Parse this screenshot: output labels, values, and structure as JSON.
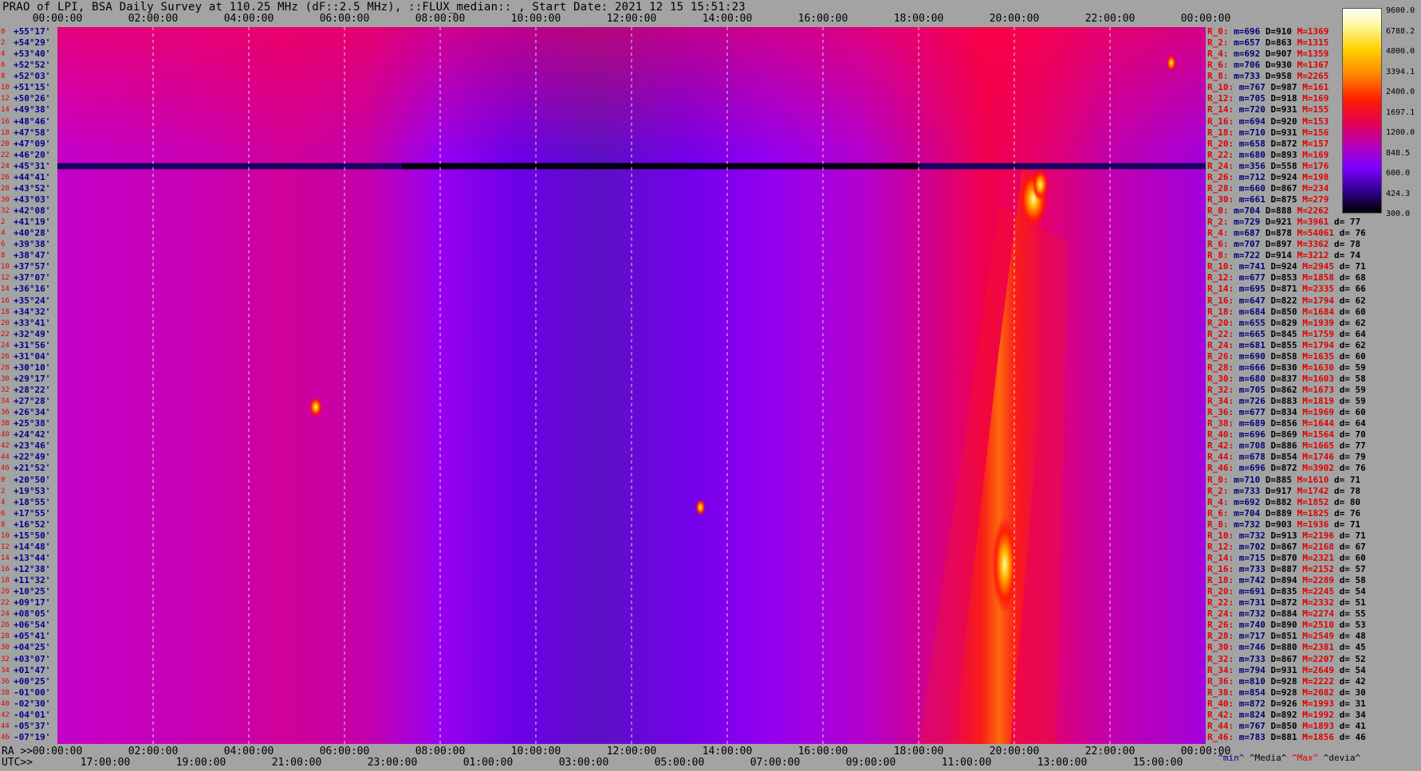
{
  "title": "PRAO of LPI, BSA Daily Survey at 110.25 MHz (dF::2.5 MHz), ::FLUX_median:: , Start Date: 2021 12 15 15:51:23",
  "chart_data": {
    "type": "heatmap",
    "title": "PRAO of LPI, BSA Daily Survey at 110.25 MHz (dF::2.5 MHz), ::FLUX_median:: , Start Date: 2021 12 15 15:51:23",
    "x_top_ticks": [
      "00:00:00",
      "02:00:00",
      "04:00:00",
      "06:00:00",
      "08:00:00",
      "10:00:00",
      "12:00:00",
      "14:00:00",
      "16:00:00",
      "18:00:00",
      "20:00:00",
      "22:00:00",
      "00:00:00"
    ],
    "x_bottom_ra_label": "RA >>",
    "x_bottom_ra_ticks": [
      "00:00:00",
      "02:00:00",
      "04:00:00",
      "06:00:00",
      "08:00:00",
      "10:00:00",
      "12:00:00",
      "14:00:00",
      "16:00:00",
      "18:00:00",
      "20:00:00",
      "22:00:00",
      "00:00:00"
    ],
    "x_bottom_utc_label": "UTC>>",
    "x_bottom_utc_ticks": [
      "17:00:00",
      "19:00:00",
      "21:00:00",
      "23:00:00",
      "01:00:00",
      "03:00:00",
      "05:00:00",
      "07:00:00",
      "09:00:00",
      "11:00:00",
      "13:00:00",
      "15:00:00"
    ],
    "colorbar_ticks": [
      "9600.0",
      "6788.2",
      "4800.0",
      "3394.1",
      "2400.0",
      "1697.1",
      "1200.0",
      "848.5",
      "600.0",
      "424.3",
      "300.0"
    ],
    "declinations": [
      {
        "i": "0",
        "dec": "+55°17'"
      },
      {
        "i": "2",
        "dec": "+54°29'"
      },
      {
        "i": "4",
        "dec": "+53°40'"
      },
      {
        "i": "6",
        "dec": "+52°52'"
      },
      {
        "i": "8",
        "dec": "+52°03'"
      },
      {
        "i": "10",
        "dec": "+51°15'"
      },
      {
        "i": "12",
        "dec": "+50°26'"
      },
      {
        "i": "14",
        "dec": "+49°38'"
      },
      {
        "i": "16",
        "dec": "+48°46'"
      },
      {
        "i": "18",
        "dec": "+47°58'"
      },
      {
        "i": "20",
        "dec": "+47°09'"
      },
      {
        "i": "22",
        "dec": "+46°20'"
      },
      {
        "i": "24",
        "dec": "+45°31'"
      },
      {
        "i": "26",
        "dec": "+44°41'"
      },
      {
        "i": "28",
        "dec": "+43°52'"
      },
      {
        "i": "30",
        "dec": "+43°03'"
      },
      {
        "i": "32",
        "dec": "+42°08'"
      },
      {
        "i": "2",
        "dec": "+41°19'"
      },
      {
        "i": "4",
        "dec": "+40°28'"
      },
      {
        "i": "6",
        "dec": "+39°38'"
      },
      {
        "i": "8",
        "dec": "+38°47'"
      },
      {
        "i": "10",
        "dec": "+37°57'"
      },
      {
        "i": "12",
        "dec": "+37°07'"
      },
      {
        "i": "14",
        "dec": "+36°16'"
      },
      {
        "i": "16",
        "dec": "+35°24'"
      },
      {
        "i": "18",
        "dec": "+34°32'"
      },
      {
        "i": "20",
        "dec": "+33°41'"
      },
      {
        "i": "22",
        "dec": "+32°49'"
      },
      {
        "i": "24",
        "dec": "+31°56'"
      },
      {
        "i": "26",
        "dec": "+31°04'"
      },
      {
        "i": "28",
        "dec": "+30°10'"
      },
      {
        "i": "30",
        "dec": "+29°17'"
      },
      {
        "i": "32",
        "dec": "+28°22'"
      },
      {
        "i": "34",
        "dec": "+27°28'"
      },
      {
        "i": "36",
        "dec": "+26°34'"
      },
      {
        "i": "38",
        "dec": "+25°38'"
      },
      {
        "i": "40",
        "dec": "+24°42'"
      },
      {
        "i": "42",
        "dec": "+23°46'"
      },
      {
        "i": "44",
        "dec": "+22°49'"
      },
      {
        "i": "46",
        "dec": "+21°52'"
      },
      {
        "i": "0",
        "dec": "+20°50'"
      },
      {
        "i": "2",
        "dec": "+19°53'"
      },
      {
        "i": "4",
        "dec": "+18°55'"
      },
      {
        "i": "6",
        "dec": "+17°55'"
      },
      {
        "i": "8",
        "dec": "+16°52'"
      },
      {
        "i": "10",
        "dec": "+15°50'"
      },
      {
        "i": "12",
        "dec": "+14°48'"
      },
      {
        "i": "14",
        "dec": "+13°44'"
      },
      {
        "i": "16",
        "dec": "+12°38'"
      },
      {
        "i": "18",
        "dec": "+11°32'"
      },
      {
        "i": "20",
        "dec": "+10°25'"
      },
      {
        "i": "22",
        "dec": "+09°17'"
      },
      {
        "i": "24",
        "dec": "+08°05'"
      },
      {
        "i": "26",
        "dec": "+06°54'"
      },
      {
        "i": "28",
        "dec": "+05°41'"
      },
      {
        "i": "30",
        "dec": "+04°25'"
      },
      {
        "i": "32",
        "dec": "+03°07'"
      },
      {
        "i": "34",
        "dec": "+01°47'"
      },
      {
        "i": "36",
        "dec": "+00°25'"
      },
      {
        "i": "38",
        "dec": "-01°00'"
      },
      {
        "i": "40",
        "dec": "-02°30'"
      },
      {
        "i": "42",
        "dec": "-04°01'"
      },
      {
        "i": "44",
        "dec": "-05°37'"
      },
      {
        "i": "46",
        "dec": "-07°19'"
      }
    ],
    "stats": [
      {
        "r": "R_0:",
        "m": "m=696",
        "d": "D=910",
        "x": "M=1369",
        "dd": ""
      },
      {
        "r": "R_2:",
        "m": "m=657",
        "d": "D=863",
        "x": "M=1315",
        "dd": ""
      },
      {
        "r": "R_4:",
        "m": "m=692",
        "d": "D=907",
        "x": "M=1359",
        "dd": ""
      },
      {
        "r": "R_6:",
        "m": "m=706",
        "d": "D=930",
        "x": "M=1367",
        "dd": ""
      },
      {
        "r": "R_8:",
        "m": "m=733",
        "d": "D=958",
        "x": "M=2265",
        "dd": ""
      },
      {
        "r": "R_10:",
        "m": "m=767",
        "d": "D=987",
        "x": "M=161",
        "dd": ""
      },
      {
        "r": "R_12:",
        "m": "m=705",
        "d": "D=918",
        "x": "M=169",
        "dd": ""
      },
      {
        "r": "R_14:",
        "m": "m=720",
        "d": "D=931",
        "x": "M=155",
        "dd": ""
      },
      {
        "r": "R_16:",
        "m": "m=694",
        "d": "D=920",
        "x": "M=153",
        "dd": ""
      },
      {
        "r": "R_18:",
        "m": "m=710",
        "d": "D=931",
        "x": "M=156",
        "dd": ""
      },
      {
        "r": "R_20:",
        "m": "m=658",
        "d": "D=872",
        "x": "M=157",
        "dd": ""
      },
      {
        "r": "R_22:",
        "m": "m=680",
        "d": "D=893",
        "x": "M=169",
        "dd": ""
      },
      {
        "r": "R_24:",
        "m": "m=356",
        "d": "D=558",
        "x": "M=176",
        "dd": ""
      },
      {
        "r": "R_26:",
        "m": "m=712",
        "d": "D=924",
        "x": "M=198",
        "dd": ""
      },
      {
        "r": "R_28:",
        "m": "m=660",
        "d": "D=867",
        "x": "M=234",
        "dd": ""
      },
      {
        "r": "R_30:",
        "m": "m=661",
        "d": "D=875",
        "x": "M=279",
        "dd": ""
      },
      {
        "r": "R_0:",
        "m": "m=704",
        "d": "D=888",
        "x": "M=2262",
        "dd": ""
      },
      {
        "r": "R_2:",
        "m": "m=729",
        "d": "D=921",
        "x": "M=3961",
        "dd": "d= 77"
      },
      {
        "r": "R_4:",
        "m": "m=687",
        "d": "D=878",
        "x": "M=54061",
        "dd": "d= 76"
      },
      {
        "r": "R_6:",
        "m": "m=707",
        "d": "D=897",
        "x": "M=3362",
        "dd": "d= 78"
      },
      {
        "r": "R_8:",
        "m": "m=722",
        "d": "D=914",
        "x": "M=3212",
        "dd": "d= 74"
      },
      {
        "r": "R_10:",
        "m": "m=741",
        "d": "D=924",
        "x": "M=2945",
        "dd": "d= 71"
      },
      {
        "r": "R_12:",
        "m": "m=677",
        "d": "D=853",
        "x": "M=1858",
        "dd": "d= 68"
      },
      {
        "r": "R_14:",
        "m": "m=695",
        "d": "D=871",
        "x": "M=2335",
        "dd": "d= 66"
      },
      {
        "r": "R_16:",
        "m": "m=647",
        "d": "D=822",
        "x": "M=1794",
        "dd": "d= 62"
      },
      {
        "r": "R_18:",
        "m": "m=684",
        "d": "D=850",
        "x": "M=1684",
        "dd": "d= 60"
      },
      {
        "r": "R_20:",
        "m": "m=655",
        "d": "D=829",
        "x": "M=1939",
        "dd": "d= 62"
      },
      {
        "r": "R_22:",
        "m": "m=665",
        "d": "D=845",
        "x": "M=1759",
        "dd": "d= 64"
      },
      {
        "r": "R_24:",
        "m": "m=681",
        "d": "D=855",
        "x": "M=1794",
        "dd": "d= 62"
      },
      {
        "r": "R_26:",
        "m": "m=690",
        "d": "D=858",
        "x": "M=1635",
        "dd": "d= 60"
      },
      {
        "r": "R_28:",
        "m": "m=666",
        "d": "D=830",
        "x": "M=1630",
        "dd": "d= 59"
      },
      {
        "r": "R_30:",
        "m": "m=680",
        "d": "D=837",
        "x": "M=1603",
        "dd": "d= 58"
      },
      {
        "r": "R_32:",
        "m": "m=705",
        "d": "D=862",
        "x": "M=1673",
        "dd": "d= 59"
      },
      {
        "r": "R_34:",
        "m": "m=726",
        "d": "D=883",
        "x": "M=1819",
        "dd": "d= 59"
      },
      {
        "r": "R_36:",
        "m": "m=677",
        "d": "D=834",
        "x": "M=1969",
        "dd": "d= 60"
      },
      {
        "r": "R_38:",
        "m": "m=689",
        "d": "D=856",
        "x": "M=1644",
        "dd": "d= 64"
      },
      {
        "r": "R_40:",
        "m": "m=696",
        "d": "D=869",
        "x": "M=1564",
        "dd": "d= 70"
      },
      {
        "r": "R_42:",
        "m": "m=708",
        "d": "D=886",
        "x": "M=1665",
        "dd": "d= 77"
      },
      {
        "r": "R_44:",
        "m": "m=678",
        "d": "D=854",
        "x": "M=1746",
        "dd": "d= 79"
      },
      {
        "r": "R_46:",
        "m": "m=696",
        "d": "D=872",
        "x": "M=3902",
        "dd": "d= 76"
      },
      {
        "r": "R_0:",
        "m": "m=710",
        "d": "D=885",
        "x": "M=1610",
        "dd": "d= 71"
      },
      {
        "r": "R_2:",
        "m": "m=733",
        "d": "D=917",
        "x": "M=1742",
        "dd": "d= 78"
      },
      {
        "r": "R_4:",
        "m": "m=692",
        "d": "D=882",
        "x": "M=1852",
        "dd": "d= 80"
      },
      {
        "r": "R_6:",
        "m": "m=704",
        "d": "D=889",
        "x": "M=1825",
        "dd": "d= 76"
      },
      {
        "r": "R_8:",
        "m": "m=732",
        "d": "D=903",
        "x": "M=1936",
        "dd": "d= 71"
      },
      {
        "r": "R_10:",
        "m": "m=732",
        "d": "D=913",
        "x": "M=2196",
        "dd": "d= 71"
      },
      {
        "r": "R_12:",
        "m": "m=702",
        "d": "D=867",
        "x": "M=2168",
        "dd": "d= 67"
      },
      {
        "r": "R_14:",
        "m": "m=715",
        "d": "D=870",
        "x": "M=2321",
        "dd": "d= 60"
      },
      {
        "r": "R_16:",
        "m": "m=733",
        "d": "D=887",
        "x": "M=2152",
        "dd": "d= 57"
      },
      {
        "r": "R_18:",
        "m": "m=742",
        "d": "D=894",
        "x": "M=2289",
        "dd": "d= 58"
      },
      {
        "r": "R_20:",
        "m": "m=691",
        "d": "D=835",
        "x": "M=2245",
        "dd": "d= 54"
      },
      {
        "r": "R_22:",
        "m": "m=731",
        "d": "D=872",
        "x": "M=2332",
        "dd": "d= 51"
      },
      {
        "r": "R_24:",
        "m": "m=732",
        "d": "D=884",
        "x": "M=2274",
        "dd": "d= 55"
      },
      {
        "r": "R_26:",
        "m": "m=740",
        "d": "D=890",
        "x": "M=2510",
        "dd": "d= 53"
      },
      {
        "r": "R_28:",
        "m": "m=717",
        "d": "D=851",
        "x": "M=2549",
        "dd": "d= 48"
      },
      {
        "r": "R_30:",
        "m": "m=746",
        "d": "D=880",
        "x": "M=2381",
        "dd": "d= 45"
      },
      {
        "r": "R_32:",
        "m": "m=733",
        "d": "D=867",
        "x": "M=2207",
        "dd": "d= 52"
      },
      {
        "r": "R_34:",
        "m": "m=794",
        "d": "D=931",
        "x": "M=2649",
        "dd": "d= 54"
      },
      {
        "r": "R_36:",
        "m": "m=810",
        "d": "D=928",
        "x": "M=2222",
        "dd": "d= 42"
      },
      {
        "r": "R_38:",
        "m": "m=854",
        "d": "D=928",
        "x": "M=2082",
        "dd": "d= 30"
      },
      {
        "r": "R_40:",
        "m": "m=872",
        "d": "D=926",
        "x": "M=1993",
        "dd": "d= 31"
      },
      {
        "r": "R_42:",
        "m": "m=824",
        "d": "D=892",
        "x": "M=1992",
        "dd": "d= 34"
      },
      {
        "r": "R_44:",
        "m": "m=767",
        "d": "D=850",
        "x": "M=1893",
        "dd": "d= 41"
      },
      {
        "r": "R_46:",
        "m": "m=783",
        "d": "D=881",
        "x": "M=1856",
        "dd": "d= 46"
      }
    ],
    "stats_footer": {
      "min": "^min^",
      "median": "^Media^",
      "max": "^Max^",
      "devia": "^devia^"
    },
    "colors": {
      "background": "#a3a3a3",
      "dark_band_row_index": 12
    }
  }
}
